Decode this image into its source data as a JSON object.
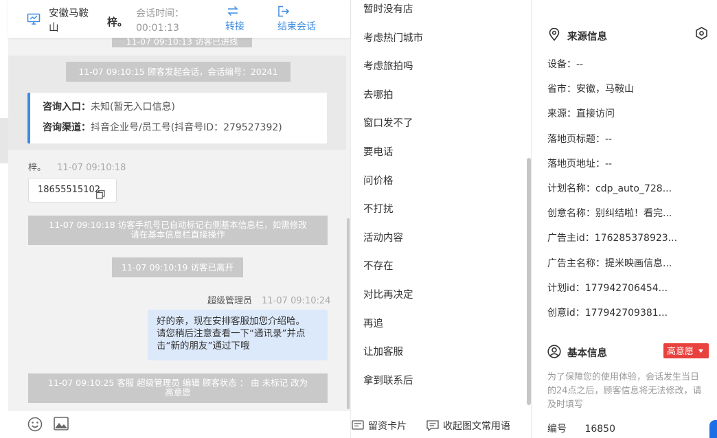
{
  "header": {
    "visitor_location_line1": "安徽马鞍",
    "visitor_location_line2": "山",
    "visitor_name": "梓。",
    "session_time_label": "会话时间：",
    "session_time_value": "00:01:13",
    "transfer_label": "转接",
    "end_session_label": "结束会话"
  },
  "chat": {
    "partial_top": "11-07 09:10:13 访客已进线",
    "session_start": "11-07 09:10:15 顾客发起会话，会话编号：20241",
    "entry_label": "咨询入口：",
    "entry_value": "未知(暂无入口信息)",
    "channel_label": "咨询渠道：",
    "channel_value": "抖音企业号/员工号(抖音号ID：279527392)",
    "visitor_sender": "梓。",
    "visitor_time": "11-07 09:10:18",
    "visitor_phone": "18655515102",
    "auto_tag_line1": "11-07 09:10:18 访客手机号已自动标记右侧基本信息栏，如需修改",
    "auto_tag_line2": "请在基本信息栏直接操作",
    "left_notice": "11-07 09:10:19 访客已离开",
    "agent_sender": "超级管理员",
    "agent_time": "11-07 09:10:24",
    "agent_msg_line1": "好的亲，现在安排客服加您介绍哈。",
    "agent_msg_line2": "请您稍后注意查看一下“通讯录”并点",
    "agent_msg_line3": "击“新的朋友”通过下哦",
    "edit_line1": "11-07 09:10:25 客服 超级管理员 编辑 顾客状态 ： 由 未标记 改为",
    "edit_line2": "高意愿"
  },
  "phrases": {
    "items": [
      "暂时没有店",
      "考虑热门城市",
      "考虑旅拍吗",
      "去哪拍",
      "窗口发不了",
      "要电话",
      "问价格",
      "不打扰",
      "活动内容",
      "不存在",
      "对比再决定",
      "再追",
      "让加客服",
      "拿到联系后"
    ],
    "card_label": "留资卡片",
    "collapse_label": "收起图文常用语"
  },
  "info": {
    "source_title": "来源信息",
    "rows": [
      "设备：--",
      "省市：安徽，马鞍山",
      "来源：直接访问",
      "落地页标题：--",
      "落地页地址：--",
      "计划名称：cdp_auto_728...",
      "创意名称：别纠结啦！看完...",
      "广告主id：176285378923...",
      "广告主名称：提米映画信息...",
      "计划id：177942706454...",
      "创意id：177942709381..."
    ],
    "basic_title": "基本信息",
    "intent_badge": "高意愿",
    "notice": "为了保障您的使用体验，会话发生当日的24点之后，顾客信息将无法修改，请及时填写",
    "id_label": "编号",
    "id_value": "16850"
  },
  "colors": {
    "accent": "#3d8be0",
    "badge": "#e8413e",
    "bubble": "#dce9fb",
    "system_msg": "#c9c9c9"
  }
}
